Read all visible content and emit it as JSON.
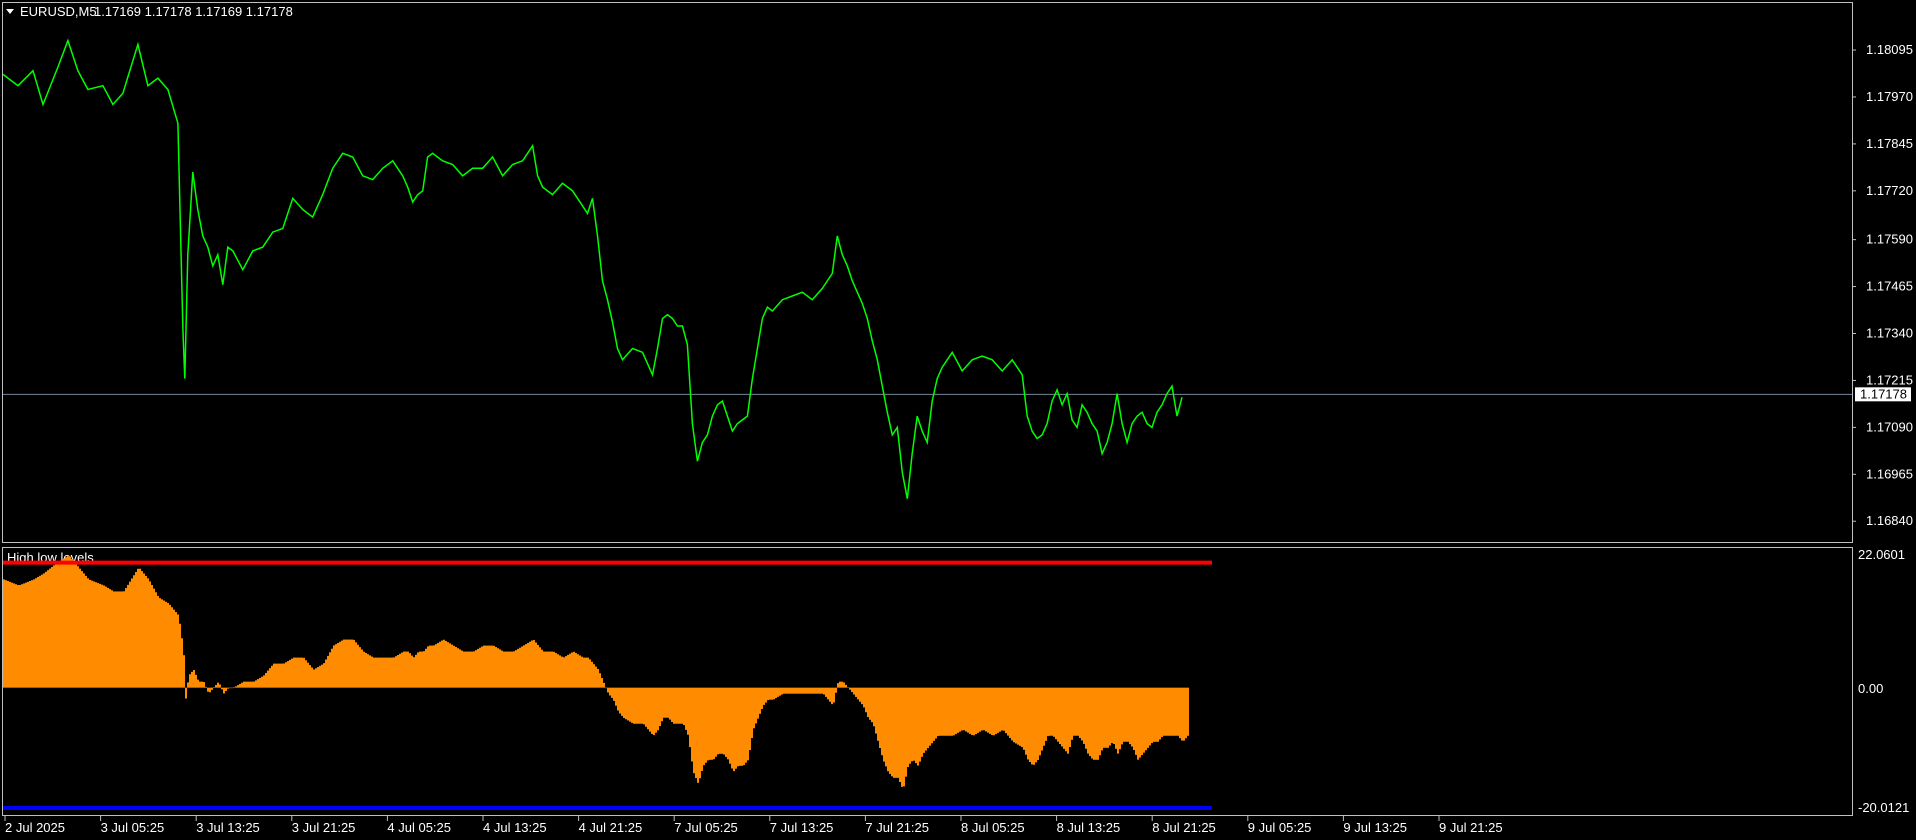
{
  "header": {
    "symbol_label": "EURUSD,M5",
    "ohlc": "1.17169 1.17178 1.17169 1.17178",
    "dropdown_icon": "triangle-down-icon"
  },
  "price_axis": {
    "ticks": [
      "1.18095",
      "1.17970",
      "1.17845",
      "1.17720",
      "1.17590",
      "1.17465",
      "1.17340",
      "1.17215",
      "1.17090",
      "1.16965",
      "1.16840"
    ],
    "current_price": "1.17178"
  },
  "indicator": {
    "name": "High low levels",
    "top_label": "22.0601",
    "zero_label": "0.00",
    "bottom_label": "-20.0121"
  },
  "time_axis": {
    "ticks": [
      "2 Jul 2025",
      "3 Jul 05:25",
      "3 Jul 13:25",
      "3 Jul 21:25",
      "4 Jul 05:25",
      "4 Jul 13:25",
      "4 Jul 21:25",
      "7 Jul 05:25",
      "7 Jul 13:25",
      "7 Jul 21:25",
      "8 Jul 05:25",
      "8 Jul 13:25",
      "8 Jul 21:25",
      "9 Jul 05:25",
      "9 Jul 13:25",
      "9 Jul 21:25"
    ]
  },
  "colors": {
    "background": "#000000",
    "price_line": "#00ff00",
    "histogram": "#ff8c00",
    "upper_level": "#ff0000",
    "lower_level": "#0000ff",
    "frame": "#c0c0c0",
    "bid_line": "#778899"
  },
  "chart_data": {
    "type": "line",
    "x": [
      0,
      15,
      30,
      40,
      55,
      65,
      75,
      85,
      100,
      110,
      120,
      135,
      145,
      155,
      165,
      175,
      180,
      182,
      185,
      190,
      195,
      200,
      205,
      210,
      215,
      220,
      225,
      230,
      240,
      250,
      260,
      270,
      280,
      290,
      300,
      310,
      320,
      330,
      340,
      350,
      360,
      370,
      380,
      390,
      400,
      405,
      410,
      415,
      420,
      425,
      430,
      440,
      450,
      460,
      470,
      480,
      490,
      500,
      510,
      520,
      530,
      535,
      540,
      550,
      560,
      570,
      580,
      585,
      590,
      595,
      600,
      605,
      610,
      615,
      620,
      630,
      640,
      650,
      655,
      660,
      665,
      670,
      675,
      680,
      685,
      690,
      695,
      700,
      705,
      710,
      715,
      720,
      725,
      730,
      735,
      740,
      745,
      750,
      755,
      760,
      765,
      770,
      780,
      790,
      800,
      810,
      820,
      830,
      835,
      840,
      845,
      850,
      855,
      860,
      865,
      870,
      875,
      880,
      885,
      890,
      895,
      900,
      905,
      910,
      915,
      920,
      925,
      930,
      935,
      940,
      945,
      950,
      960,
      970,
      980,
      990,
      1000,
      1010,
      1020,
      1025,
      1030,
      1035,
      1040,
      1045,
      1050,
      1055,
      1060,
      1065,
      1070,
      1075,
      1080,
      1085,
      1090,
      1095,
      1100,
      1105,
      1110,
      1115,
      1120,
      1125,
      1130,
      1135,
      1140,
      1145,
      1150,
      1155,
      1160,
      1165,
      1170,
      1175,
      1180,
      1185,
      1190,
      1195,
      1200,
      1205,
      1210
    ],
    "values": [
      1.1803,
      1.18,
      1.1804,
      1.1795,
      1.1805,
      1.1812,
      1.1804,
      1.1799,
      1.18,
      1.1795,
      1.1798,
      1.1811,
      1.18,
      1.1802,
      1.1799,
      1.179,
      1.1735,
      1.1722,
      1.1755,
      1.1777,
      1.1767,
      1.176,
      1.1757,
      1.1752,
      1.1755,
      1.1747,
      1.1757,
      1.1756,
      1.1751,
      1.1756,
      1.1757,
      1.1761,
      1.1762,
      1.177,
      1.1767,
      1.1765,
      1.1771,
      1.1778,
      1.1782,
      1.1781,
      1.1776,
      1.1775,
      1.1778,
      1.178,
      1.1776,
      1.1773,
      1.1769,
      1.1771,
      1.1772,
      1.1781,
      1.1782,
      1.178,
      1.1779,
      1.1776,
      1.1778,
      1.1778,
      1.1781,
      1.1776,
      1.1779,
      1.178,
      1.1784,
      1.1776,
      1.1773,
      1.1771,
      1.1774,
      1.1772,
      1.1768,
      1.1766,
      1.177,
      1.176,
      1.1748,
      1.1743,
      1.1737,
      1.173,
      1.1727,
      1.173,
      1.1729,
      1.1723,
      1.173,
      1.1738,
      1.1739,
      1.1738,
      1.1736,
      1.1736,
      1.1731,
      1.171,
      1.17,
      1.1705,
      1.1707,
      1.1712,
      1.1715,
      1.1716,
      1.1712,
      1.1708,
      1.171,
      1.1711,
      1.1712,
      1.1722,
      1.173,
      1.1738,
      1.1741,
      1.174,
      1.1743,
      1.1744,
      1.1745,
      1.1743,
      1.1746,
      1.175,
      1.176,
      1.1755,
      1.1752,
      1.1748,
      1.1745,
      1.1742,
      1.1738,
      1.1732,
      1.1727,
      1.172,
      1.1713,
      1.1707,
      1.1709,
      1.1697,
      1.169,
      1.1702,
      1.1712,
      1.1708,
      1.1705,
      1.1716,
      1.1722,
      1.1725,
      1.1727,
      1.1729,
      1.1724,
      1.1727,
      1.1728,
      1.1727,
      1.1724,
      1.1727,
      1.1723,
      1.1712,
      1.1708,
      1.1706,
      1.1707,
      1.171,
      1.1716,
      1.1719,
      1.1715,
      1.1718,
      1.1711,
      1.1709,
      1.1715,
      1.1713,
      1.171,
      1.1708,
      1.1702,
      1.1705,
      1.171,
      1.1718,
      1.171,
      1.1705,
      1.171,
      1.1712,
      1.1713,
      1.171,
      1.1709,
      1.1713,
      1.1715,
      1.1718,
      1.172,
      1.1712,
      1.1717
    ],
    "histogram_values": [
      18,
      17,
      18,
      19,
      21,
      22,
      20,
      18,
      17,
      16,
      16,
      20,
      18,
      15,
      14,
      12,
      6,
      -2,
      2,
      3,
      1,
      1,
      -1,
      0,
      1,
      -1,
      0,
      0,
      1,
      1,
      2,
      4,
      4,
      5,
      5,
      3,
      4,
      7,
      8,
      8,
      6,
      5,
      5,
      5,
      6,
      6,
      5,
      6,
      6,
      7,
      7,
      8,
      7,
      6,
      6,
      7,
      7,
      6,
      6,
      7,
      8,
      7,
      6,
      6,
      5,
      6,
      5,
      5,
      4,
      3,
      1,
      -1,
      -2,
      -4,
      -5,
      -6,
      -6,
      -8,
      -7,
      -5,
      -5,
      -6,
      -6,
      -6,
      -8,
      -14,
      -16,
      -13,
      -12,
      -12,
      -11,
      -11,
      -12,
      -14,
      -13,
      -13,
      -12,
      -7,
      -5,
      -3,
      -2,
      -2,
      -1,
      -1,
      -1,
      -1,
      -1,
      -3,
      1,
      1,
      0,
      -1,
      -2,
      -3,
      -5,
      -6,
      -9,
      -12,
      -14,
      -15,
      -15,
      -17,
      -13,
      -12,
      -13,
      -11,
      -10,
      -9,
      -8,
      -8,
      -8,
      -8,
      -7,
      -8,
      -7,
      -8,
      -7,
      -9,
      -10,
      -12,
      -13,
      -12,
      -10,
      -8,
      -8,
      -9,
      -10,
      -11,
      -8,
      -8,
      -9,
      -11,
      -12,
      -12,
      -10,
      -10,
      -9,
      -11,
      -9,
      -9,
      -10,
      -12,
      -11,
      -10,
      -9,
      -9,
      -8,
      -8,
      -8,
      -8,
      -9,
      -8
    ],
    "price_ylim": [
      1.1679,
      1.18175
    ],
    "indicator_ylim": [
      -20.0121,
      22.0601
    ],
    "upper_level": 20.8,
    "lower_level": -20.0121,
    "current_price": 1.17178
  }
}
